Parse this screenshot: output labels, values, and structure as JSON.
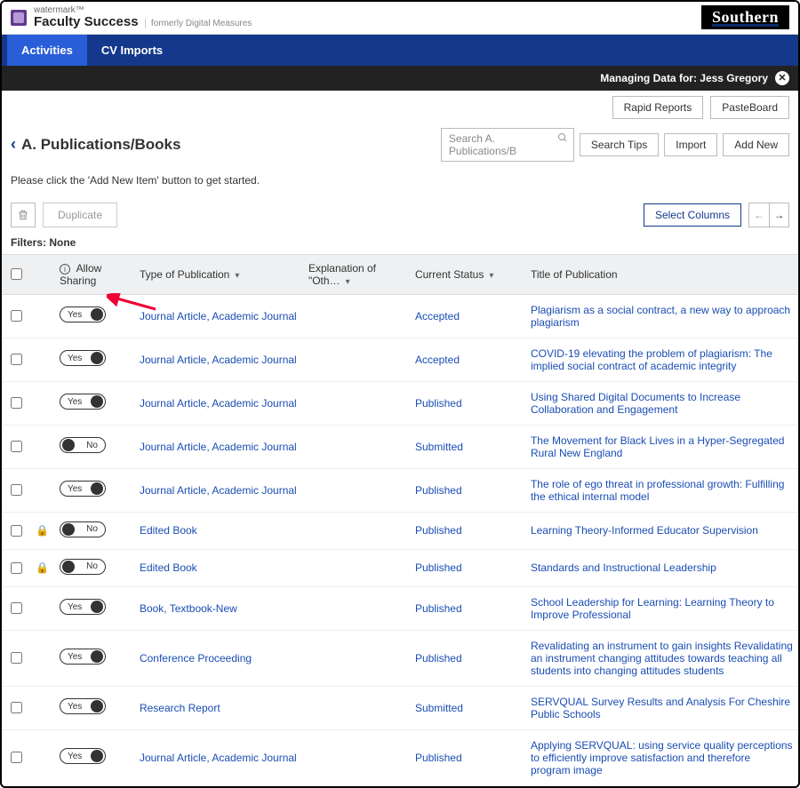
{
  "brand": {
    "small": "watermark™",
    "main": "Faculty Success",
    "sub": "formerly Digital Measures",
    "right_logo": "Southern"
  },
  "nav": {
    "activities": "Activities",
    "cv_imports": "CV Imports"
  },
  "subbar": {
    "prefix": "Managing Data for:",
    "name": "Jess Gregory"
  },
  "buttons": {
    "rapid_reports": "Rapid Reports",
    "pasteboard": "PasteBoard",
    "search_tips": "Search Tips",
    "import": "Import",
    "add_new": "Add New",
    "duplicate": "Duplicate",
    "select_columns": "Select Columns"
  },
  "page": {
    "title": "A. Publications/Books",
    "search_placeholder": "Search A. Publications/B",
    "instruction": "Please click the 'Add New Item' button to get started.",
    "filters": "Filters: None"
  },
  "columns": {
    "allow_sharing": "Allow Sharing",
    "type": "Type of Publication",
    "explanation": "Explanation of \"Oth…",
    "current_status": "Current Status",
    "title": "Title of Publication"
  },
  "toggle_labels": {
    "yes": "Yes",
    "no": "No"
  },
  "rows": [
    {
      "locked": false,
      "share": "yes",
      "type": "Journal Article, Academic Journal",
      "status": "Accepted",
      "title": "Plagiarism as a social contract, a new way to approach plagiarism"
    },
    {
      "locked": false,
      "share": "yes",
      "type": "Journal Article, Academic Journal",
      "status": "Accepted",
      "title": "COVID-19 elevating the problem of plagiarism: The implied social contract of academic integrity"
    },
    {
      "locked": false,
      "share": "yes",
      "type": "Journal Article, Academic Journal",
      "status": "Published",
      "title": "Using Shared Digital Documents to Increase Collaboration and Engagement"
    },
    {
      "locked": false,
      "share": "no",
      "type": "Journal Article, Academic Journal",
      "status": "Submitted",
      "title": "The Movement for Black Lives in a Hyper-Segregated Rural New England"
    },
    {
      "locked": false,
      "share": "yes",
      "type": "Journal Article, Academic Journal",
      "status": "Published",
      "title": "The role of ego threat in professional growth: Fulfilling the ethical internal model"
    },
    {
      "locked": true,
      "share": "no",
      "type": "Edited Book",
      "status": "Published",
      "title": "Learning Theory-Informed Educator Supervision"
    },
    {
      "locked": true,
      "share": "no",
      "type": "Edited Book",
      "status": "Published",
      "title": "Standards and Instructional Leadership"
    },
    {
      "locked": false,
      "share": "yes",
      "type": "Book, Textbook-New",
      "status": "Published",
      "title": "School Leadership for Learning: Learning Theory to Improve Professional"
    },
    {
      "locked": false,
      "share": "yes",
      "type": "Conference Proceeding",
      "status": "Published",
      "title": "Revalidating an instrument to gain insights Revalidating an instrument changing attitudes towards teaching all students into changing attitudes students"
    },
    {
      "locked": false,
      "share": "yes",
      "type": "Research Report",
      "status": "Submitted",
      "title": "SERVQUAL Survey Results and Analysis For Cheshire Public Schools"
    },
    {
      "locked": false,
      "share": "yes",
      "type": "Journal Article, Academic Journal",
      "status": "Published",
      "title": "Applying SERVQUAL: using service quality perceptions to efficiently improve satisfaction and therefore program image"
    }
  ]
}
